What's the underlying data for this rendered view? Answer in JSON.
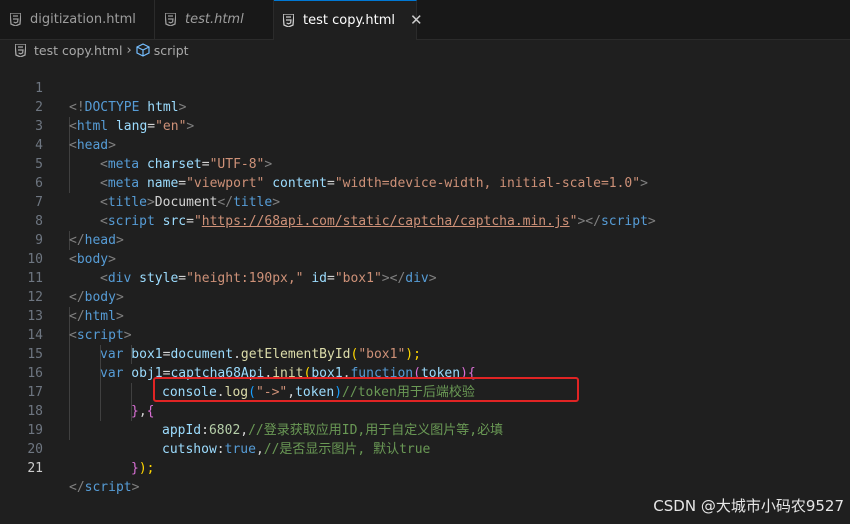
{
  "tabs": [
    {
      "label": "digitization.html",
      "icon": "html5-icon",
      "italic": false,
      "active": false
    },
    {
      "label": "test.html",
      "icon": "html5-icon",
      "italic": true,
      "active": false
    },
    {
      "label": "test copy.html",
      "icon": "html5-icon",
      "italic": false,
      "active": true,
      "close": "✕"
    }
  ],
  "breadcrumb": {
    "file": "test copy.html",
    "separator": "›",
    "symbol": "script"
  },
  "editor": {
    "current_line": 21,
    "lines": [
      {
        "n": "1"
      },
      {
        "n": "2"
      },
      {
        "n": "3"
      },
      {
        "n": "4"
      },
      {
        "n": "5"
      },
      {
        "n": "6"
      },
      {
        "n": "7"
      },
      {
        "n": "8"
      },
      {
        "n": "9"
      },
      {
        "n": "10"
      },
      {
        "n": "11"
      },
      {
        "n": "12"
      },
      {
        "n": "13"
      },
      {
        "n": "14"
      },
      {
        "n": "15"
      },
      {
        "n": "16"
      },
      {
        "n": "17"
      },
      {
        "n": "18"
      },
      {
        "n": "19"
      },
      {
        "n": "20"
      },
      {
        "n": "21"
      }
    ],
    "code": {
      "l1": [
        "<!",
        "DOCTYPE",
        " html",
        ">"
      ],
      "l2": [
        "<",
        "html",
        " lang",
        "=",
        "\"en\"",
        ">"
      ],
      "l3": [
        "<",
        "head",
        ">"
      ],
      "l4": [
        "<",
        "meta",
        " charset",
        "=",
        "\"UTF-8\"",
        ">"
      ],
      "l5": [
        "<",
        "meta",
        " name",
        "=",
        "\"viewport\"",
        " content",
        "=",
        "\"width=device-width, initial-scale=1.0\"",
        ">"
      ],
      "l6": [
        "<",
        "title",
        ">",
        "Document",
        "</",
        "title",
        ">"
      ],
      "l7": [
        "<",
        "script",
        " src",
        "=",
        "\"",
        "https://68api.com/static/captcha/captcha.min.js",
        "\"",
        "></",
        "script",
        ">"
      ],
      "l8": [
        "</",
        "head",
        ">"
      ],
      "l9": [
        "<",
        "body",
        ">"
      ],
      "l10": [
        "<",
        "div",
        " style",
        "=",
        "\"height:190px,\"",
        " id",
        "=",
        "\"box1\"",
        "></",
        "div",
        ">"
      ],
      "l11": [
        "</",
        "body",
        ">"
      ],
      "l12": [
        "</",
        "html",
        ">"
      ],
      "l13": [
        "<",
        "script",
        ">"
      ],
      "l14": [
        "var",
        " box1",
        "=",
        "document",
        ".",
        "getElementById",
        "(",
        "\"box1\"",
        ");"
      ],
      "l15": [
        "var",
        " obj1",
        "=",
        "captcha68Api",
        ".",
        "init",
        "(",
        "box1",
        ",",
        "function",
        "(",
        "token",
        ")",
        "{"
      ],
      "l16": [
        "console",
        ".",
        "log",
        "(",
        "\"->\"",
        ",",
        "token",
        ")",
        "//token用于后端校验"
      ],
      "l17": [
        "}",
        ",",
        "{"
      ],
      "l18": [
        "appId",
        ":",
        "6802",
        ",",
        "//登录获取应用ID,用于自定义图片等,必填"
      ],
      "l19": [
        "cutshow",
        ":",
        "true",
        ",",
        "//是否显示图片, 默认true"
      ],
      "l20": [
        "}",
        ");"
      ],
      "l21": [
        "</",
        "script",
        ">"
      ]
    }
  },
  "watermark": "CSDN @大城市小码农9527",
  "colors": {
    "background": "#1f1f1f",
    "tag_name": "#569cd6",
    "attribute": "#9cdcfe",
    "string": "#ce9178",
    "function": "#dcdcaa",
    "comment": "#6a9955",
    "number": "#b5cea8",
    "highlight_box": "#e02424",
    "active_tab_accent": "#0078d4"
  }
}
